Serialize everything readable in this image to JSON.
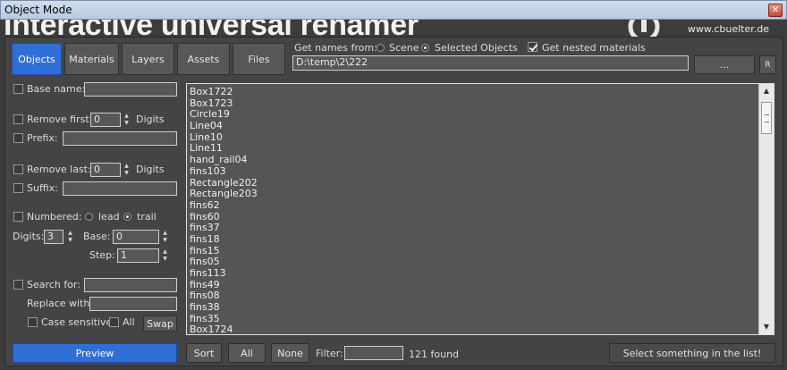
{
  "window": {
    "title": "Object Mode",
    "close_glyph": "✕"
  },
  "banner": {
    "title": "Interactive universal renamer",
    "site": "www.cbuelter.de"
  },
  "tabs": [
    {
      "label": "Objects",
      "active": true
    },
    {
      "label": "Materials"
    },
    {
      "label": "Layers"
    },
    {
      "label": "Assets"
    },
    {
      "label": "Files"
    }
  ],
  "source": {
    "label": "Get names from:",
    "scene_label": "Scene",
    "selected_label": "Selected Objects",
    "selected": "Selected Objects",
    "nested_label": "Get nested materials",
    "nested_checked": true,
    "path": "D:\\temp\\2\\222",
    "browse_label": "...",
    "r_label": "R"
  },
  "options": {
    "base_name": {
      "label": "Base name:",
      "value": ""
    },
    "remove_first": {
      "label": "Remove first:",
      "value": "0",
      "unit": "Digits"
    },
    "prefix": {
      "label": "Prefix:",
      "value": ""
    },
    "remove_last": {
      "label": "Remove last:",
      "value": "0",
      "unit": "Digits"
    },
    "suffix": {
      "label": "Suffix:",
      "value": ""
    },
    "numbered": {
      "label": "Numbered:",
      "lead_label": "lead",
      "trail_label": "trail",
      "selected": "trail"
    },
    "digits": {
      "label": "Digits:",
      "value": "3"
    },
    "base": {
      "label": "Base:",
      "value": "0"
    },
    "step": {
      "label": "Step:",
      "value": "1"
    },
    "search": {
      "label": "Search for:",
      "value": ""
    },
    "replace": {
      "label": "Replace with:",
      "value": ""
    },
    "case_label": "Case sensitive",
    "all_label": "All",
    "swap_label": "Swap"
  },
  "list": {
    "items": [
      "Box1722",
      "Box1723",
      "Circle19",
      "Line04",
      "Line10",
      "Line11",
      "hand_rail04",
      "fins103",
      "Rectangle202",
      "Rectangle203",
      "fins62",
      "fins60",
      "fins37",
      "fins18",
      "fins15",
      "fins05",
      "fins113",
      "fins49",
      "fins08",
      "fins38",
      "fins35",
      "Box1724"
    ]
  },
  "bottom": {
    "preview_label": "Preview",
    "sort_label": "Sort",
    "all_label": "All",
    "none_label": "None",
    "filter_label": "Filter:",
    "filter_value": "",
    "found_text": "121 found",
    "select_label": "Select something in the list!"
  },
  "colors": {
    "accent": "#2f6fd6",
    "panel": "#444444",
    "list_bg": "#555555"
  }
}
